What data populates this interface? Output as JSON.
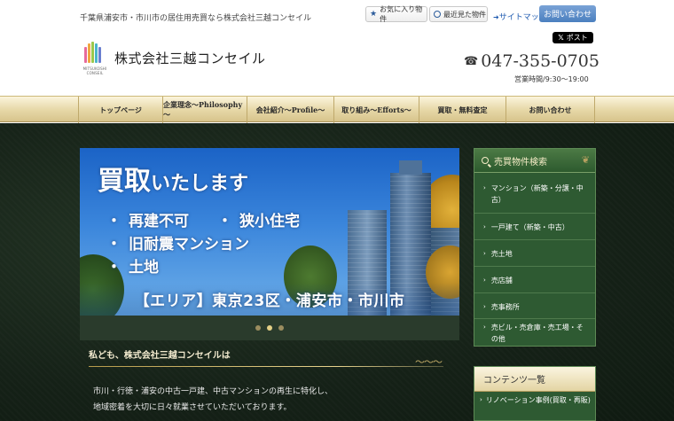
{
  "header": {
    "tagline": "千葉県浦安市・市川市の居住用売買なら株式会社三越コンセイル",
    "favorites_label": "お気に入り物件",
    "recent_label": "最近見た物件",
    "sitemap_label": "サイトマップ",
    "contact_label": "お問い合わせ",
    "x_post_label": "ポスト",
    "company_name": "株式会社三越コンセイル",
    "logo_text": "MITSUKOSHI CONSEIL",
    "phone": "047-355-0705",
    "hours": "営業時間/9:30～19:00"
  },
  "nav": {
    "items": [
      {
        "label": "トップページ"
      },
      {
        "label": "企業理念～Philosophy～"
      },
      {
        "label": "会社紹介～Profile～"
      },
      {
        "label": "取り組み～Efforts～"
      },
      {
        "label": "買取・無料査定"
      },
      {
        "label": "お問い合わせ"
      }
    ]
  },
  "slider": {
    "title_big": "買取",
    "title_small": "いたします",
    "points": [
      "再建不可",
      "狭小住宅",
      "旧耐震マンション",
      "土地"
    ],
    "area": "【エリア】東京23区・浦安市・市川市",
    "total_slides": 3,
    "active_slide": 2
  },
  "intro": {
    "heading": "私ども、株式会社三越コンセイルは",
    "flourish": "〜〜〜",
    "lines": [
      "市川・行徳・浦安の中古一戸建、中古マンションの再生に特化し、",
      "地域密着を大切に日々就業させていただいております。"
    ]
  },
  "sidebar": {
    "search_title": "売買物件検索",
    "search_items": [
      {
        "label": "マンション（新築・分譲・中古）"
      },
      {
        "label": "一戸建て（新築・中古）"
      },
      {
        "label": "売土地"
      },
      {
        "label": "売店舗"
      },
      {
        "label": "売事務所"
      },
      {
        "label": "売ビル・売倉庫・売工場・その他"
      }
    ],
    "contents_title": "コンテンツ一覧",
    "contents_items": [
      {
        "label": "リノベーション事例(買取・再販)"
      }
    ]
  },
  "colors": {
    "nav_gold": "#e6d7a6",
    "sidebar_green": "#2e5a32",
    "contact_blue": "#4b7fbf",
    "background_dark": "#152117"
  }
}
